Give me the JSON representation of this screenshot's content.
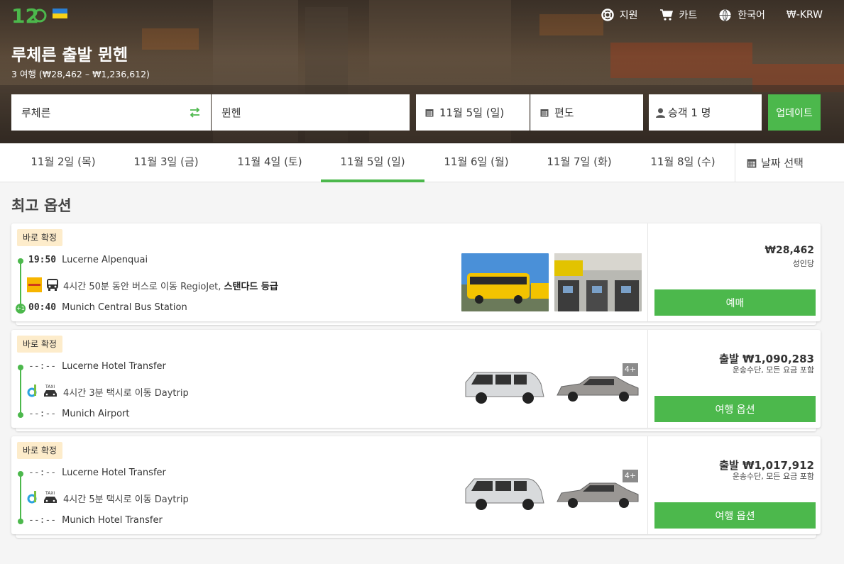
{
  "header": {
    "nav": [
      {
        "icon": "lifebuoy-icon",
        "label": "지원"
      },
      {
        "icon": "cart-icon",
        "label": "카트"
      },
      {
        "icon": "globe-icon",
        "label": "한국어"
      },
      {
        "icon": "currency-icon",
        "label": "₩-KRW"
      }
    ],
    "title": "루체른 출발 뮌헨",
    "subtitle": "3 여행 (₩28,462 – ₩1,236,612)"
  },
  "search": {
    "from": "루체른",
    "to": "뮌헨",
    "date": "11월 5일 (일)",
    "return": "편도",
    "passengers": "승객 1 명",
    "update_label": "업데이트"
  },
  "dates": {
    "tabs": [
      "11월 2일 (목)",
      "11월 3일 (금)",
      "11월 4일 (토)",
      "11월 5일 (일)",
      "11월 6일 (월)",
      "11월 7일 (화)",
      "11월 8일 (수)"
    ],
    "active_index": 3,
    "picker_label": "날짜 선택"
  },
  "section_title": "최고 옵션",
  "colors": {
    "accent": "#4cb84c",
    "badge_bg": "#fdeccb"
  },
  "results": [
    {
      "badge": "바로 확정",
      "depart_time": "19:50",
      "depart_place": "Lucerne Alpenquai",
      "leg_text": "4시간 50분 동안 버스로 이동 RegioJet,",
      "leg_class": "스탠다드 등급",
      "arrive_time": "00:40",
      "arrive_place": "Munich Central Bus Station",
      "next_day": "+1",
      "price": "₩28,462",
      "price_note": "성인당",
      "button": "예매"
    },
    {
      "badge": "바로 확정",
      "depart_time": "--:--",
      "depart_place": "Lucerne Hotel Transfer",
      "leg_text": "4시간 3분 택시로 이동 Daytrip",
      "arrive_time": "--:--",
      "arrive_place": "Munich Airport",
      "capacity": "4+",
      "price": "출발 ₩1,090,283",
      "price_note": "운송수단, 모든 요금 포함",
      "button": "여행 옵션"
    },
    {
      "badge": "바로 확정",
      "depart_time": "--:--",
      "depart_place": "Lucerne Hotel Transfer",
      "leg_text": "4시간 5분 택시로 이동 Daytrip",
      "arrive_time": "--:--",
      "arrive_place": "Munich Hotel Transfer",
      "capacity": "4+",
      "price": "출발 ₩1,017,912",
      "price_note": "운송수단, 모든 요금 포함",
      "button": "여행 옵션"
    }
  ]
}
